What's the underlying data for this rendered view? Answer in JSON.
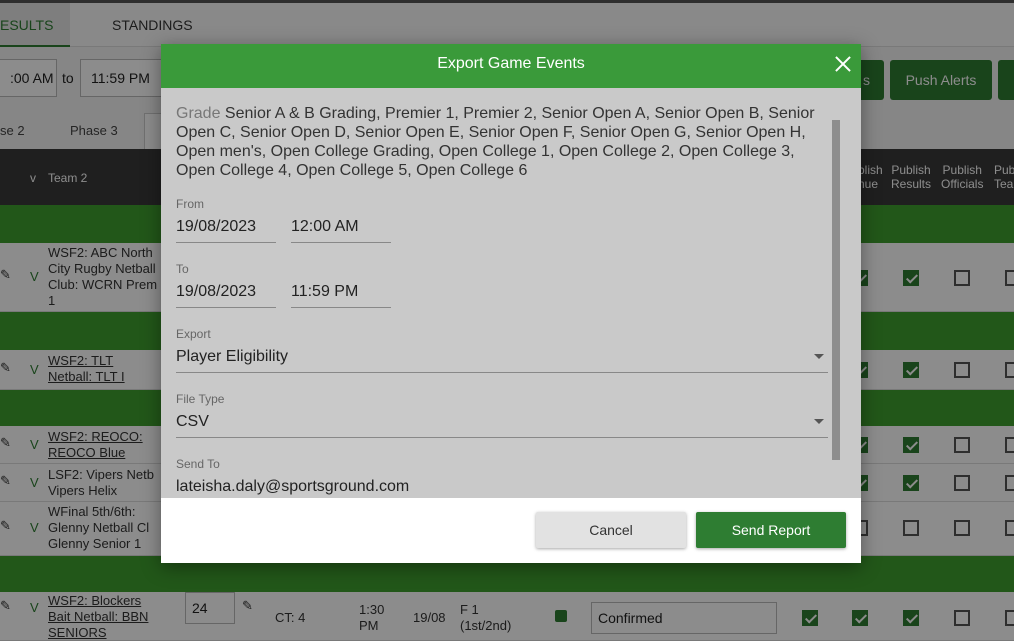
{
  "tabs": {
    "results": "ESULTS",
    "standings": "STANDINGS"
  },
  "filters": {
    "from_time": ":00 AM",
    "to_label": "to",
    "to_time": "11:59 PM"
  },
  "actions": {
    "button_a": "s",
    "push_alerts": "Push Alerts"
  },
  "phases": [
    "se 2",
    "Phase 3"
  ],
  "table_header": {
    "v": "v",
    "team2": "Team 2",
    "publish_venue": "blish\nnue",
    "publish_results": "Publish\nResults",
    "publish_officials": "Publish\nOfficials",
    "publish_team": "Pub\nTea"
  },
  "rows": [
    {
      "v": "V",
      "team2": "WSF2: ABC North City Rugby Netball Club: WCRN Prem 1"
    },
    {
      "v": "V",
      "team2": "WSF2: TLT Netball: TLT I"
    },
    {
      "v": "V",
      "team2": "WSF2: REOCO: REOCO Blue"
    },
    {
      "v": "V",
      "team2": "LSF2: Vipers Netb Vipers Helix"
    },
    {
      "v": "V",
      "team2": "WFinal 5th/6th: Glenny Netball Cl Glenny Senior 1"
    },
    {
      "v": "V",
      "team2": "WSF2: Blockers Bait Netball: BBN SENIORS",
      "score": "24",
      "ct": "CT: 4",
      "time": "1:30\nPM",
      "date": "19/08",
      "round": "F 1\n(1st/2nd)",
      "status": "Confirmed"
    }
  ],
  "modal": {
    "title": "Export Game Events",
    "grade_label": "Grade",
    "grade_value": "Senior A & B Grading, Premier 1, Premier 2, Senior Open A, Senior Open B, Senior Open C, Senior Open D, Senior Open E, Senior Open F, Senior Open G, Senior Open H, Open men's, Open College Grading, Open College 1, Open College 2, Open College 3, Open College 4, Open College 5, Open College 6",
    "from_label": "From",
    "from_date": "19/08/2023",
    "from_time": "12:00 AM",
    "to_label": "To",
    "to_date": "19/08/2023",
    "to_time": "11:59 PM",
    "export_label": "Export",
    "export_value": "Player Eligibility",
    "filetype_label": "File Type",
    "filetype_value": "CSV",
    "sendto_label": "Send To",
    "sendto_value": "lateisha.daly@sportsground.com",
    "cancel_label": "Cancel",
    "send_label": "Send Report"
  },
  "colors": {
    "brand_green": "#2e7d32",
    "header_green": "#3a9a3a",
    "group_green": "#3f9e2f"
  }
}
